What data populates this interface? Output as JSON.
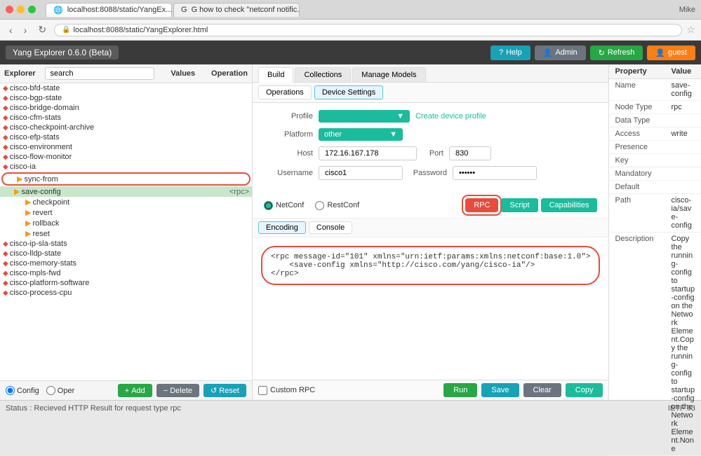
{
  "browser": {
    "tab1_label": "localhost:8088/static/YangEx...",
    "tab2_label": "G  how to check \"netconf notific...",
    "url": "localhost:8088/static/YangExplorer.html",
    "user": "Mike"
  },
  "header": {
    "title": "Yang Explorer 0.6.0 (Beta)",
    "help_label": "Help",
    "admin_label": "Admin",
    "refresh_label": "Refresh",
    "guest_label": "guest"
  },
  "sidebar": {
    "search_placeholder": "search",
    "values_label": "Values",
    "operation_label": "Operation",
    "items": [
      {
        "label": "cisco-bfd-state",
        "type": "module",
        "indent": 0
      },
      {
        "label": "cisco-bgp-state",
        "type": "module",
        "indent": 0
      },
      {
        "label": "cisco-bridge-domain",
        "type": "module",
        "indent": 0
      },
      {
        "label": "cisco-cfm-stats",
        "type": "module",
        "indent": 0
      },
      {
        "label": "cisco-checkpoint-archive",
        "type": "module",
        "indent": 0
      },
      {
        "label": "cisco-efp-stats",
        "type": "module",
        "indent": 0
      },
      {
        "label": "cisco-environment",
        "type": "module",
        "indent": 0
      },
      {
        "label": "cisco-flow-monitor",
        "type": "module",
        "indent": 0
      },
      {
        "label": "cisco-ia",
        "type": "module",
        "indent": 0
      },
      {
        "label": "sync-from",
        "type": "folder",
        "indent": 1
      },
      {
        "label": "save-config",
        "type": "folder",
        "indent": 1,
        "selected": true,
        "value": "<rpc>"
      },
      {
        "label": "checkpoint",
        "type": "folder",
        "indent": 2
      },
      {
        "label": "revert",
        "type": "folder",
        "indent": 2
      },
      {
        "label": "rollback",
        "type": "folder",
        "indent": 2
      },
      {
        "label": "reset",
        "type": "folder",
        "indent": 2
      },
      {
        "label": "cisco-ip-sla-stats",
        "type": "module",
        "indent": 0
      },
      {
        "label": "cisco-lldp-state",
        "type": "module",
        "indent": 0
      },
      {
        "label": "cisco-memory-stats",
        "type": "module",
        "indent": 0
      },
      {
        "label": "cisco-mpls-fwd",
        "type": "module",
        "indent": 0
      },
      {
        "label": "cisco-platform-software",
        "type": "module",
        "indent": 0
      },
      {
        "label": "cisco-process-cpu",
        "type": "module",
        "indent": 0
      }
    ],
    "config_label": "Config",
    "oper_label": "Oper",
    "add_label": "Add",
    "delete_label": "Delete",
    "reset_label": "Reset"
  },
  "build_tabs": {
    "build_label": "Build",
    "collections_label": "Collections",
    "manage_models_label": "Manage Models"
  },
  "sub_tabs": {
    "operations_label": "Operations",
    "device_settings_label": "Device Settings"
  },
  "form": {
    "profile_label": "Profile",
    "profile_placeholder": "",
    "create_profile_link": "Create device profile",
    "platform_label": "Platform",
    "platform_value": "other",
    "host_label": "Host",
    "host_value": "172.16.167.178",
    "port_label": "Port",
    "port_value": "830",
    "username_label": "Username",
    "username_value": "cisco1",
    "password_label": "Password",
    "password_value": "cisco1"
  },
  "protocol": {
    "netconf_label": "NetConf",
    "restconf_label": "RestConf",
    "rpc_label": "RPC",
    "script_label": "Script",
    "capabilities_label": "Capabilities"
  },
  "encoding": {
    "encoding_label": "Encoding",
    "console_label": "Console",
    "code": "<rpc message-id=\"101\" xmlns=\"urn:ietf:params:xmlns:netconf:base:1.0\">\n    <save-config xmlns=\"http://cisco.com/yang/cisco-ia\"/>\n</rpc>"
  },
  "bottom": {
    "custom_rpc_label": "Custom RPC",
    "run_label": "Run",
    "save_label": "Save",
    "clear_label": "Clear",
    "copy_label": "Copy"
  },
  "property": {
    "property_col": "Property",
    "value_col": "Value",
    "rows": [
      {
        "key": "Name",
        "value": "save-config"
      },
      {
        "key": "Node Type",
        "value": "rpc"
      },
      {
        "key": "Data Type",
        "value": ""
      },
      {
        "key": "Access",
        "value": "write"
      },
      {
        "key": "Presence",
        "value": ""
      },
      {
        "key": "Key",
        "value": ""
      },
      {
        "key": "Mandatory",
        "value": ""
      },
      {
        "key": "Default",
        "value": ""
      },
      {
        "key": "Path",
        "value": "cisco-ia/save-config"
      },
      {
        "key": "Description",
        "value": "Copy the running-config to startup-config on the Network Element.Copy the running-config to startup-config on the Network Element.None"
      }
    ]
  },
  "status": {
    "text": "Status : Recieved HTTP Result for request type rpc",
    "right": "IETF 93"
  }
}
